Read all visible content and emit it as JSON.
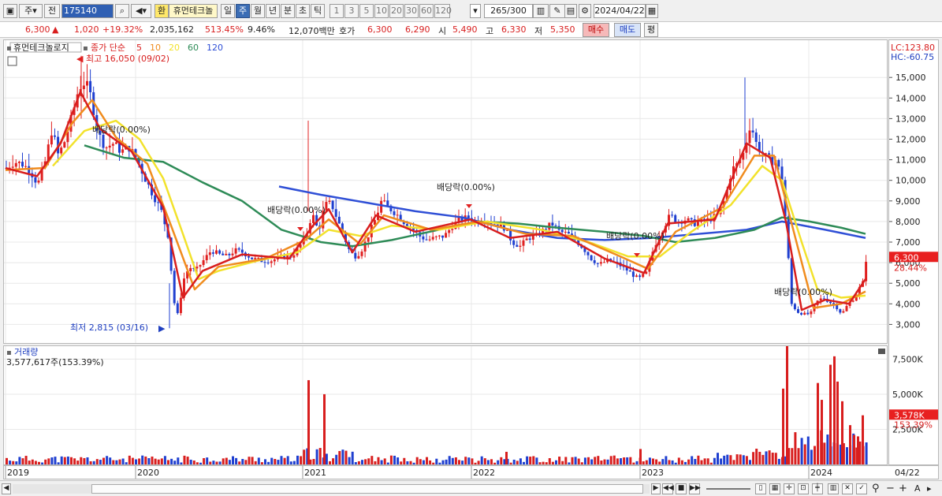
{
  "toolbar": {
    "market": "주",
    "period_mode": "전",
    "code": "175140",
    "hwan": "환",
    "name": "휴먼테크놀",
    "periods": [
      "일",
      "주",
      "월",
      "년",
      "분",
      "초",
      "틱"
    ],
    "active_period": "주",
    "nums": [
      "1",
      "3",
      "5",
      "10",
      "20",
      "30",
      "60",
      "120"
    ],
    "count": "265",
    "count_total": "/300",
    "date": "2024/04/22"
  },
  "quote": {
    "price": "6,300",
    "change_arrow": "▲",
    "change": "1,020",
    "change_pct": "+19.32%",
    "volume": "2,035,162",
    "vol_ratio": "513.45%",
    "turnover": "9.46%",
    "amount": "12,070백만",
    "hoga_label": "호가",
    "ask": "6,300",
    "bid": "6,290",
    "open_label": "시",
    "open": "5,490",
    "high_label": "고",
    "high": "6,330",
    "low_label": "저",
    "low": "5,350",
    "buy_btn": "매수",
    "sell_btn": "매도",
    "eval_btn": "평"
  },
  "legend": {
    "stock": "휴먼테크놀로지",
    "ma_title": "종가 단순",
    "ma": [
      {
        "p": "5",
        "color": "#d81e1e"
      },
      {
        "p": "10",
        "color": "#f08c1e"
      },
      {
        "p": "20",
        "color": "#f2e22c"
      },
      {
        "p": "60",
        "color": "#2e8b57"
      },
      {
        "p": "120",
        "color": "#2f4fd6"
      }
    ]
  },
  "annotations": {
    "high": "최고 16,050 (09/02)",
    "low": "최저 2,815 (03/16)",
    "dividend": "배당락(0.00%)"
  },
  "right": {
    "lc": "LC:123.80",
    "hc": "HC:-60.75",
    "price_tag": "6,300",
    "price_pct": "28.44%",
    "vol_tag": "3,578K",
    "vol_pct": "153.39%"
  },
  "volume_panel": {
    "title": "거래량",
    "value": "3,577,617주(153.39%)"
  },
  "xaxis_end": "04/22",
  "chart_data": {
    "type": "candlestick",
    "frequency": "weekly",
    "x_labels": [
      "2019",
      "2020",
      "2021",
      "2022",
      "2023",
      "2024"
    ],
    "y_ticks": [
      3000,
      4000,
      5000,
      6000,
      7000,
      8000,
      9000,
      10000,
      11000,
      12000,
      13000,
      14000,
      15000
    ],
    "ylim": [
      2500,
      16150
    ],
    "volume_ticks": [
      "2,500K",
      "5,000K",
      "7,500K"
    ],
    "close_path": [
      [
        0,
        10600
      ],
      [
        10,
        10900
      ],
      [
        20,
        10800
      ],
      [
        30,
        10500
      ],
      [
        40,
        9800
      ],
      [
        50,
        11000
      ],
      [
        58,
        12500
      ],
      [
        66,
        11200
      ],
      [
        74,
        11900
      ],
      [
        84,
        13200
      ],
      [
        92,
        14500
      ],
      [
        100,
        14800
      ],
      [
        108,
        14000
      ],
      [
        116,
        12300
      ],
      [
        126,
        11600
      ],
      [
        136,
        11800
      ],
      [
        146,
        11400
      ],
      [
        156,
        11600
      ],
      [
        166,
        11000
      ],
      [
        176,
        10100
      ],
      [
        186,
        9300
      ],
      [
        196,
        8600
      ],
      [
        206,
        7200
      ],
      [
        212,
        4200
      ],
      [
        218,
        3400
      ],
      [
        224,
        5100
      ],
      [
        232,
        5800
      ],
      [
        240,
        5600
      ],
      [
        250,
        6100
      ],
      [
        260,
        6600
      ],
      [
        270,
        6400
      ],
      [
        280,
        6300
      ],
      [
        290,
        6600
      ],
      [
        300,
        6500
      ],
      [
        312,
        6200
      ],
      [
        324,
        6100
      ],
      [
        336,
        6100
      ],
      [
        350,
        6300
      ],
      [
        362,
        6300
      ],
      [
        372,
        6800
      ],
      [
        380,
        7300
      ],
      [
        388,
        8400
      ],
      [
        396,
        7500
      ],
      [
        404,
        8800
      ],
      [
        412,
        8900
      ],
      [
        420,
        8100
      ],
      [
        428,
        7300
      ],
      [
        436,
        6500
      ],
      [
        444,
        6300
      ],
      [
        452,
        6700
      ],
      [
        460,
        7400
      ],
      [
        468,
        8100
      ],
      [
        476,
        9000
      ],
      [
        484,
        8700
      ],
      [
        494,
        8400
      ],
      [
        504,
        8000
      ],
      [
        514,
        7700
      ],
      [
        524,
        7300
      ],
      [
        534,
        7100
      ],
      [
        544,
        7200
      ],
      [
        556,
        7300
      ],
      [
        566,
        7800
      ],
      [
        576,
        8100
      ],
      [
        586,
        8200
      ],
      [
        596,
        8000
      ],
      [
        606,
        8100
      ],
      [
        618,
        7900
      ],
      [
        630,
        7800
      ],
      [
        642,
        7000
      ],
      [
        652,
        6800
      ],
      [
        662,
        7200
      ],
      [
        672,
        7300
      ],
      [
        682,
        7600
      ],
      [
        692,
        7900
      ],
      [
        702,
        7500
      ],
      [
        712,
        7400
      ],
      [
        722,
        7100
      ],
      [
        732,
        6700
      ],
      [
        742,
        6200
      ],
      [
        752,
        5900
      ],
      [
        762,
        6100
      ],
      [
        772,
        6000
      ],
      [
        782,
        5800
      ],
      [
        792,
        5500
      ],
      [
        802,
        5200
      ],
      [
        812,
        5500
      ],
      [
        822,
        6800
      ],
      [
        832,
        7600
      ],
      [
        842,
        8300
      ],
      [
        852,
        8000
      ],
      [
        862,
        8100
      ],
      [
        872,
        7900
      ],
      [
        882,
        8000
      ],
      [
        892,
        8100
      ],
      [
        902,
        8300
      ],
      [
        912,
        9100
      ],
      [
        920,
        10500
      ],
      [
        928,
        10800
      ],
      [
        936,
        11400
      ],
      [
        944,
        12800
      ],
      [
        952,
        11700
      ],
      [
        960,
        11300
      ],
      [
        968,
        10900
      ],
      [
        976,
        11000
      ],
      [
        984,
        10100
      ],
      [
        990,
        7400
      ],
      [
        996,
        4000
      ],
      [
        1004,
        3600
      ],
      [
        1012,
        3500
      ],
      [
        1020,
        3500
      ],
      [
        1028,
        4100
      ],
      [
        1036,
        4300
      ],
      [
        1044,
        4100
      ],
      [
        1052,
        3900
      ],
      [
        1060,
        3500
      ],
      [
        1068,
        4000
      ],
      [
        1076,
        4300
      ],
      [
        1084,
        4900
      ],
      [
        1088,
        5100
      ],
      [
        1091,
        6300
      ]
    ],
    "series": [
      {
        "name": "5",
        "color": "#d81e1e",
        "values": [
          [
            0,
            10600
          ],
          [
            40,
            10200
          ],
          [
            70,
            11800
          ],
          [
            95,
            14300
          ],
          [
            120,
            12500
          ],
          [
            160,
            11400
          ],
          [
            200,
            8700
          ],
          [
            225,
            4300
          ],
          [
            250,
            5600
          ],
          [
            300,
            6400
          ],
          [
            360,
            6200
          ],
          [
            390,
            7800
          ],
          [
            410,
            8600
          ],
          [
            440,
            6500
          ],
          [
            470,
            8300
          ],
          [
            520,
            7500
          ],
          [
            590,
            8100
          ],
          [
            640,
            7200
          ],
          [
            700,
            7500
          ],
          [
            760,
            6200
          ],
          [
            810,
            5500
          ],
          [
            840,
            7900
          ],
          [
            900,
            8100
          ],
          [
            940,
            11800
          ],
          [
            970,
            11100
          ],
          [
            990,
            8000
          ],
          [
            1010,
            3700
          ],
          [
            1040,
            4200
          ],
          [
            1070,
            4000
          ],
          [
            1091,
            5200
          ]
        ]
      },
      {
        "name": "10",
        "color": "#f08c1e",
        "values": [
          [
            0,
            10500
          ],
          [
            50,
            10600
          ],
          [
            85,
            12800
          ],
          [
            110,
            13900
          ],
          [
            140,
            12100
          ],
          [
            180,
            10800
          ],
          [
            210,
            7800
          ],
          [
            240,
            4700
          ],
          [
            270,
            5800
          ],
          [
            330,
            6200
          ],
          [
            380,
            7100
          ],
          [
            410,
            8100
          ],
          [
            450,
            6900
          ],
          [
            480,
            8300
          ],
          [
            540,
            7600
          ],
          [
            600,
            8000
          ],
          [
            660,
            7400
          ],
          [
            720,
            7300
          ],
          [
            780,
            6300
          ],
          [
            815,
            5700
          ],
          [
            850,
            7500
          ],
          [
            910,
            8700
          ],
          [
            950,
            11200
          ],
          [
            975,
            11200
          ],
          [
            1000,
            7500
          ],
          [
            1025,
            3800
          ],
          [
            1060,
            4000
          ],
          [
            1091,
            4600
          ]
        ]
      },
      {
        "name": "20",
        "color": "#f2e22c",
        "values": [
          [
            60,
            10700
          ],
          [
            100,
            12400
          ],
          [
            140,
            12900
          ],
          [
            170,
            12000
          ],
          [
            200,
            10100
          ],
          [
            225,
            7400
          ],
          [
            245,
            5200
          ],
          [
            270,
            5600
          ],
          [
            320,
            6100
          ],
          [
            370,
            6500
          ],
          [
            410,
            7600
          ],
          [
            450,
            7300
          ],
          [
            490,
            7800
          ],
          [
            550,
            7600
          ],
          [
            610,
            8000
          ],
          [
            680,
            7600
          ],
          [
            740,
            7000
          ],
          [
            790,
            6300
          ],
          [
            830,
            6300
          ],
          [
            870,
            7500
          ],
          [
            920,
            8800
          ],
          [
            960,
            10700
          ],
          [
            985,
            10000
          ],
          [
            1010,
            7000
          ],
          [
            1030,
            4700
          ],
          [
            1060,
            4300
          ],
          [
            1091,
            4400
          ]
        ]
      },
      {
        "name": "60",
        "color": "#2e8b57",
        "values": [
          [
            100,
            11700
          ],
          [
            150,
            11100
          ],
          [
            200,
            10900
          ],
          [
            250,
            9900
          ],
          [
            300,
            9000
          ],
          [
            350,
            7600
          ],
          [
            400,
            7000
          ],
          [
            440,
            6800
          ],
          [
            490,
            7100
          ],
          [
            550,
            7600
          ],
          [
            600,
            8000
          ],
          [
            650,
            7900
          ],
          [
            700,
            7700
          ],
          [
            760,
            7500
          ],
          [
            810,
            7300
          ],
          [
            850,
            7000
          ],
          [
            900,
            7200
          ],
          [
            950,
            7600
          ],
          [
            985,
            8200
          ],
          [
            1020,
            8000
          ],
          [
            1060,
            7700
          ],
          [
            1091,
            7400
          ]
        ]
      },
      {
        "name": "120",
        "color": "#2f4fd6",
        "values": [
          [
            347,
            9700
          ],
          [
            400,
            9300
          ],
          [
            460,
            8900
          ],
          [
            520,
            8500
          ],
          [
            580,
            8200
          ],
          [
            640,
            7600
          ],
          [
            700,
            7200
          ],
          [
            760,
            7100
          ],
          [
            820,
            7200
          ],
          [
            880,
            7400
          ],
          [
            940,
            7600
          ],
          [
            985,
            8000
          ],
          [
            1040,
            7600
          ],
          [
            1091,
            7200
          ]
        ]
      }
    ]
  }
}
